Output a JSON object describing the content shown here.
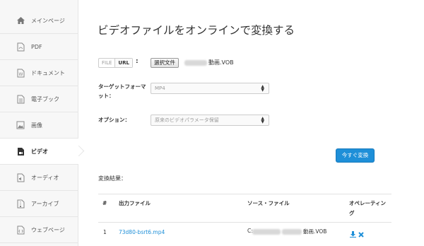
{
  "sidebar": {
    "items": [
      {
        "label": "メインページ",
        "icon": "home-icon"
      },
      {
        "label": "PDF",
        "icon": "pdf-file-icon"
      },
      {
        "label": "ドキュメント",
        "icon": "word-document-icon"
      },
      {
        "label": "電子ブック",
        "icon": "ebook-icon"
      },
      {
        "label": "画像",
        "icon": "image-icon"
      },
      {
        "label": "ビデオ",
        "icon": "video-icon",
        "active": true
      },
      {
        "label": "オーディオ",
        "icon": "audio-icon"
      },
      {
        "label": "アーカイブ",
        "icon": "archive-icon"
      },
      {
        "label": "ウェブページ",
        "icon": "webpage-icon"
      }
    ]
  },
  "main": {
    "title": "ビデオファイルをオンラインで変換する",
    "source": {
      "mode_file": "FILE",
      "mode_url": "URL",
      "colon": ":",
      "choose_button": "選択文件",
      "file_name": "動画.VOB"
    },
    "target_format": {
      "label": "ターゲットフォーマット：",
      "value": "MP4"
    },
    "options": {
      "label": "オプション：",
      "value": "原来のビデオパラメータ保留"
    },
    "convert_button": "今すぐ変換",
    "results": {
      "label": "変換結果：",
      "headers": [
        "#",
        "出力ファイル",
        "ソース・ファイル",
        "オペレーティング"
      ],
      "rows": [
        {
          "num": "1",
          "output": "73d80-bsrt6.mp4",
          "source_prefix": "C:",
          "source_suffix": "動画.VOB"
        }
      ]
    }
  },
  "colors": {
    "accent": "#1e8fd8",
    "sidebar_bg": "#f7f7f7"
  }
}
